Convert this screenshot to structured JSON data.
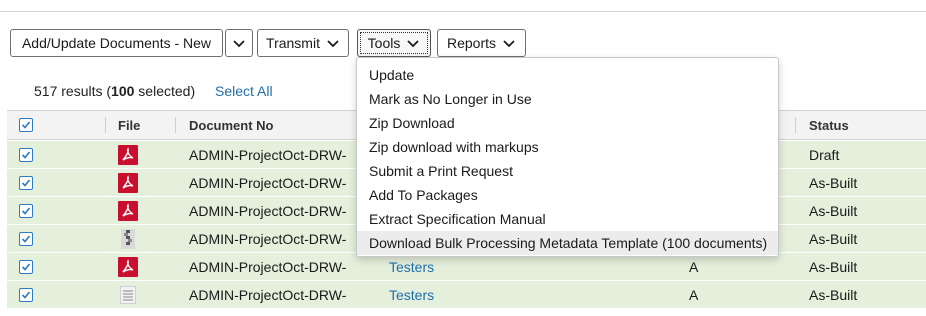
{
  "toolbar": {
    "add_update_label": "Add/Update Documents - New",
    "transmit_label": "Transmit",
    "tools_label": "Tools",
    "reports_label": "Reports"
  },
  "results": {
    "count": "517 results (",
    "selected_count": "100",
    "selected_suffix": " selected)",
    "select_all_label": "Select All"
  },
  "table": {
    "columns": [
      "File",
      "Document No",
      "Status"
    ],
    "rows": [
      {
        "file_type": "pdf-icon",
        "document_no": "ADMIN-ProjectOct-DRW-",
        "mid": "",
        "rev": "",
        "status": "Draft"
      },
      {
        "file_type": "pdf-icon",
        "document_no": "ADMIN-ProjectOct-DRW-",
        "mid": "",
        "rev": "",
        "status": "As-Built"
      },
      {
        "file_type": "pdf-icon",
        "document_no": "ADMIN-ProjectOct-DRW-",
        "mid": "",
        "rev": "",
        "status": "As-Built"
      },
      {
        "file_type": "zip-icon",
        "document_no": "ADMIN-ProjectOct-DRW-",
        "mid": "",
        "rev": "",
        "status": "As-Built"
      },
      {
        "file_type": "pdf-icon",
        "document_no": "ADMIN-ProjectOct-DRW-",
        "mid": "Testers",
        "rev": "A",
        "status": "As-Built"
      },
      {
        "file_type": "doc-icon",
        "document_no": "ADMIN-ProjectOct-DRW-",
        "mid": "Testers",
        "rev": "A",
        "status": "As-Built"
      }
    ]
  },
  "tools_menu": {
    "items": [
      "Update",
      "Mark as No Longer in Use",
      "Zip Download",
      "Zip download with markups",
      "Submit a Print Request",
      "Add To Packages",
      "Extract Specification Manual",
      "Download Bulk Processing Metadata Template (100 documents)"
    ],
    "highlighted_index": 7
  },
  "colors": {
    "row_selected": "#e4efdc",
    "link": "#1f6fa8",
    "checkbox": "#2b7cc4",
    "pdf": "#c8102e"
  }
}
